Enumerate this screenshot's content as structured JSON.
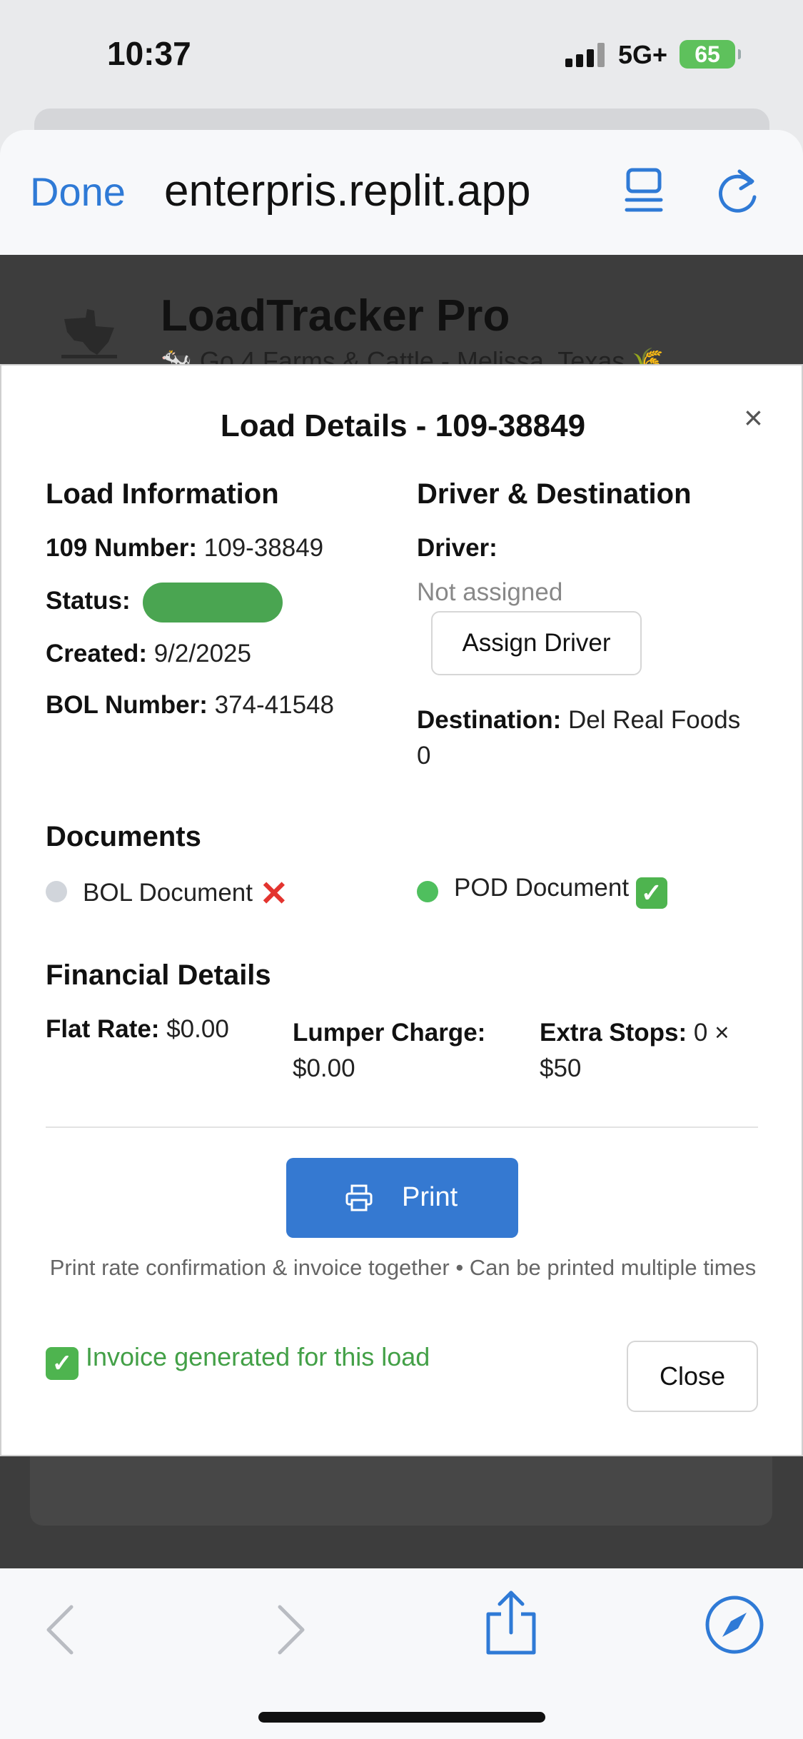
{
  "status_bar": {
    "time": "10:37",
    "network": "5G+",
    "battery": "65"
  },
  "browser": {
    "done_label": "Done",
    "url": "enterpris.replit.app"
  },
  "background_page": {
    "app_title": "LoadTracker Pro",
    "subtitle": "🐄 Go 4 Farms & Cattle - Melissa, Texas 🌾"
  },
  "modal": {
    "title": "Load Details - 109-38849",
    "close_symbol": "×",
    "load_info": {
      "heading": "Load Information",
      "number_label": "109 Number:",
      "number_value": "109-38849",
      "status_label": "Status:",
      "created_label": "Created:",
      "created_value": "9/2/2025",
      "bol_label": "BOL Number:",
      "bol_value": "374-41548"
    },
    "driver": {
      "heading": "Driver & Destination",
      "driver_label": "Driver:",
      "driver_value": "Not assigned",
      "assign_button": "Assign Driver",
      "destination_label": "Destination:",
      "destination_value": "Del Real Foods",
      "destination_extra": "0"
    },
    "documents": {
      "heading": "Documents",
      "bol": {
        "label": "BOL Document",
        "status_mark": "✕",
        "dot_color": "#d1d5db"
      },
      "pod": {
        "label": "POD Document",
        "status_mark": "✓",
        "dot_color": "#4fbf5e"
      }
    },
    "financial": {
      "heading": "Financial Details",
      "flat_rate_label": "Flat Rate:",
      "flat_rate_value": "$0.00",
      "lumper_label": "Lumper Charge:",
      "lumper_value": "$0.00",
      "extra_stops_label": "Extra Stops:",
      "extra_stops_value_line1": "0 ×",
      "extra_stops_value_line2": "$50"
    },
    "print_button": "Print",
    "print_note": "Print rate confirmation & invoice together • Can be printed multiple times",
    "invoice_message": "Invoice generated for this load",
    "close_button": "Close"
  },
  "colors": {
    "accent": "#3579d1",
    "status_green": "#4aa551",
    "success_text": "#43a047"
  }
}
